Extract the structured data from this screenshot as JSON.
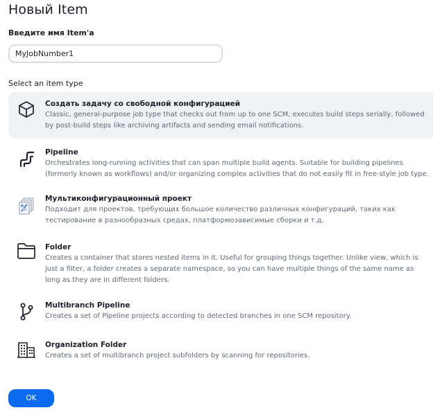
{
  "page": {
    "title": "Новый Item"
  },
  "form": {
    "name_label": "Введите имя Item'а",
    "name_value": "MyJobNumber1",
    "type_label": "Select an item type"
  },
  "items": [
    {
      "name": "Создать задачу со свободной конфигурацией",
      "description": "Classic, general-purpose job type that checks out from up to one SCM, executes build steps serially, followed by post-build steps like archiving artifacts and sending email notifications.",
      "icon": "cube-icon",
      "selected": true
    },
    {
      "name": "Pipeline",
      "description": "Orchestrates long-running activities that can span multiple build agents. Suitable for building pipelines (formerly known as workflows) and/or organizing complex activities that do not easily fit in free-style job type.",
      "icon": "pipeline-icon",
      "selected": false
    },
    {
      "name": "Мультиконфигурационный проект",
      "description": "Подходит для проектов, требующих большое количество различных конфигураций, таких как тестирование в разнообразных средах, платформозависимые сборки и т.д.",
      "icon": "multi-config-icon",
      "selected": false
    },
    {
      "name": "Folder",
      "description": "Creates a container that stores nested items in it. Useful for grouping things together. Unlike view, which is just a filter, a folder creates a separate namespace, so you can have multiple things of the same name as long as they are in different folders.",
      "icon": "folder-icon",
      "selected": false
    },
    {
      "name": "Multibranch Pipeline",
      "description": "Creates a set of Pipeline projects according to detected branches in one SCM repository.",
      "icon": "branch-icon",
      "selected": false
    },
    {
      "name": "Organization Folder",
      "description": "Creates a set of multibranch project subfolders by scanning for repositories.",
      "icon": "building-icon",
      "selected": false
    }
  ],
  "buttons": {
    "ok": "OK"
  },
  "colors": {
    "accent": "#0b6bf0",
    "selected_bg": "#f0f1f5",
    "description_text": "#5e6878"
  }
}
